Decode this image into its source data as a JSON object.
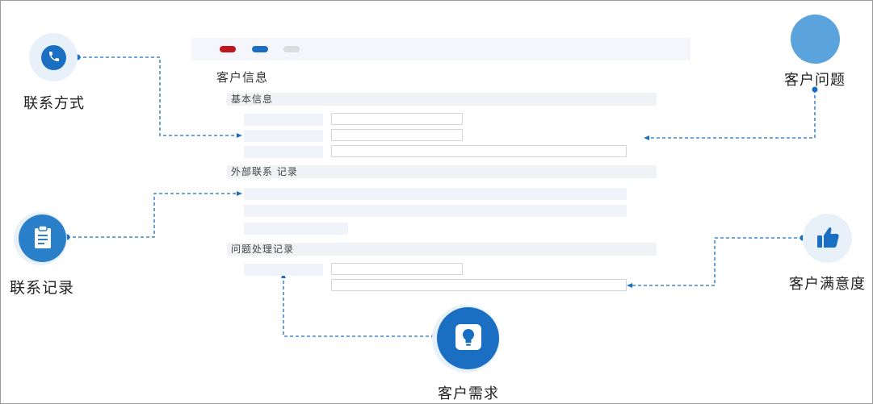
{
  "form": {
    "title": "客户信息",
    "sections": {
      "basic": "基本信息",
      "contacts": "外部联系 记录",
      "issues": "问题处理记录"
    }
  },
  "nodes": {
    "contact_method": {
      "label": "联系方式",
      "icon": "phone-icon"
    },
    "contact_record": {
      "label": "联系记录",
      "icon": "clipboard-icon"
    },
    "customer_need": {
      "label": "客户需求",
      "icon": "lightbulb-icon"
    },
    "customer_issue": {
      "label": "客户问题",
      "icon": "circle"
    },
    "customer_satisfaction": {
      "label": "客户满意度",
      "icon": "thumbs-up-icon"
    }
  },
  "colors": {
    "accent": "#1a6fc3",
    "light_accent": "#5ba3dc",
    "halo": "#e8f1fa",
    "red": "#c0161b",
    "bar": "#f4f6fb"
  }
}
